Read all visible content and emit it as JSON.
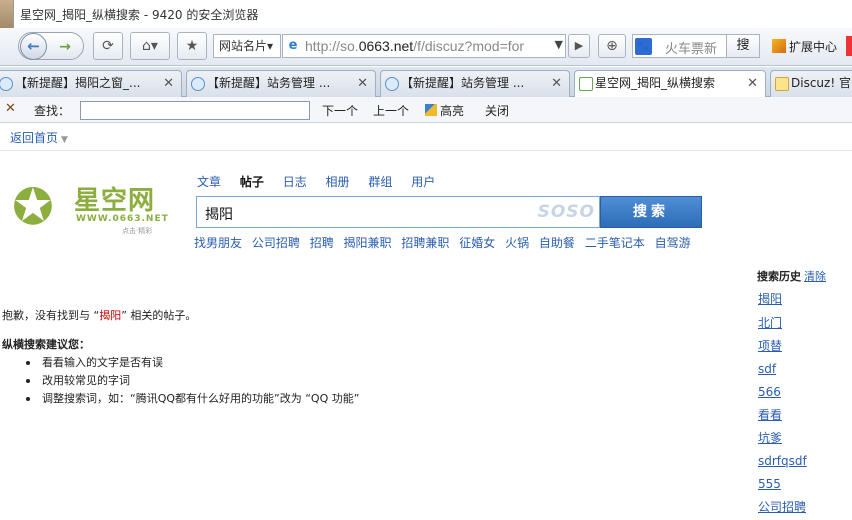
{
  "window": {
    "title": "星空网_揭阳_纵横搜索 - 9420 的安全浏览器"
  },
  "toolbar": {
    "back_icon": "arrow-left-icon",
    "forward_icon": "arrow-right-icon",
    "refresh_icon": "refresh-icon",
    "home_icon": "home-icon",
    "favorite_icon": "star-icon",
    "address_dropdown_label": "网站名片▾",
    "url_prefix": "http://so.",
    "url_domain": "0663.net",
    "url_rest": "/f/discuz?mod=for",
    "search_engine_value": "火车票新",
    "search_button_label": "搜",
    "extension_label": "扩展中心"
  },
  "tabs": [
    {
      "label": "【新提醒】揭阳之窗_...",
      "icon": "ie-icon",
      "active": false
    },
    {
      "label": "【新提醒】站务管理 ...",
      "icon": "ie-icon",
      "active": false
    },
    {
      "label": "【新提醒】站务管理 ...",
      "icon": "ie-icon",
      "active": false
    },
    {
      "label": "星空网_揭阳_纵横搜索",
      "icon": "page-icon",
      "active": true
    },
    {
      "label": "Discuz! 官",
      "icon": "discuz-icon",
      "active": false
    }
  ],
  "findbar": {
    "label": "查找：",
    "value": "",
    "next": "下一个",
    "prev": "上一个",
    "highlight": "高亮",
    "close": "关闭"
  },
  "page": {
    "back_home": "返回首页",
    "logo": {
      "name": "星空网",
      "site": "WWW.0663.NET",
      "slogan": "点击·精彩"
    },
    "categories": [
      "文章",
      "帖子",
      "日志",
      "相册",
      "群组",
      "用户"
    ],
    "current_category": "帖子",
    "search_value": "揭阳",
    "search_watermark": "SOSO",
    "search_button": "搜索",
    "hotwords": [
      "找男朋友",
      "公司招聘",
      "招聘",
      "揭阳兼职",
      "招聘兼职",
      "征婚女",
      "火锅",
      "自助餐",
      "二手笔记本",
      "自驾游"
    ],
    "noresult_prefix": "抱歉，没有找到与 “",
    "noresult_keyword": "揭阳",
    "noresult_suffix": "” 相关的帖子。",
    "tips_title": "纵横搜索建议您：",
    "tips": [
      "看看输入的文字是否有误",
      "改用较常见的字词",
      "调整搜索词，如：“腾讯QQ都有什么好用的功能”改为 “QQ 功能”"
    ],
    "history": {
      "title": "搜索历史",
      "clear": "清除",
      "items": [
        "揭阳",
        "北门",
        "项替",
        "sdf",
        "566",
        "看看",
        "坑爹",
        "sdrfqsdf",
        "555",
        "公司招聘"
      ]
    }
  }
}
